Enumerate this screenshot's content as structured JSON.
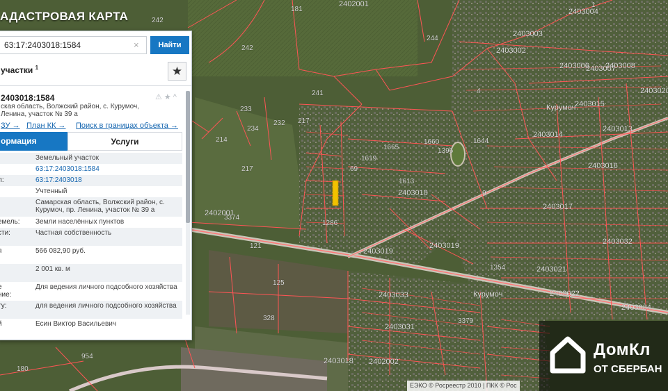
{
  "app": {
    "title": "АДАСТРОВАЯ КАРТА"
  },
  "search": {
    "value": "63:17:2403018:1584",
    "clear_icon": "×",
    "button_label": "Найти"
  },
  "list": {
    "title": "участки",
    "count": "1",
    "star_icon": "★"
  },
  "card": {
    "id": "2403018:1584",
    "address": "ская область, Волжский район, с. Курумоч, Ленина, участок № 39 а",
    "icons": "⚠★^",
    "links": {
      "link1": "ЗУ →",
      "plan_kk": "План КК →",
      "search_bounds": "Поиск в границах объекта →"
    },
    "tabs": {
      "info": "ормация",
      "services": "Услуги"
    },
    "rows": [
      {
        "label": "",
        "value": "Земельный участок"
      },
      {
        "label": "",
        "value": "63:17:2403018:1584"
      },
      {
        "label": "л:",
        "value": "63:17:2403018"
      },
      {
        "label": "",
        "value": "Учтенный"
      },
      {
        "label": "",
        "value": "Самарская область, Волжский район, с. Курумоч, пр. Ленина, участок № 39 а"
      },
      {
        "label": "емель:",
        "value": "Земли населённых пунктов"
      },
      {
        "label": "сти:",
        "value": "Частная собственность"
      },
      {
        "label": "я",
        "value": "566 082,90 руб."
      },
      {
        "label": "",
        "value": "2 001 кв. м"
      },
      {
        "label": "е",
        "value": "Для ведения личного подсобного хозяйства"
      },
      {
        "label": "ние:",
        "value": ""
      },
      {
        "label": "ту:",
        "value": "для ведения личного подсобного хозяйства"
      },
      {
        "label": "й",
        "value": "Есин Виктор Васильевич"
      }
    ]
  },
  "map": {
    "labels": [
      "242",
      "181",
      "2402001",
      "244",
      "242",
      "241",
      "214",
      "233",
      "234",
      "232",
      "217",
      "217",
      "2402001",
      "3374",
      "121",
      "125",
      "328",
      "954",
      "180",
      "2402002",
      "2403018",
      "1665",
      "1619",
      "1660",
      "1396",
      "1644",
      "69",
      "1613",
      "2403018",
      "1286",
      "2403019",
      "2403019",
      "9",
      "1354",
      "2403017",
      "4",
      "Курумоч",
      "2403015",
      "2403014",
      "2403013",
      "2403016",
      "2403002",
      "2403003",
      "2403004",
      "1",
      "2403006",
      "2403007",
      "2403008",
      "2403020",
      "2403021",
      "2403032",
      "2403033",
      "2403031",
      "3379",
      "Курумоч",
      "2403022",
      "2403034"
    ]
  },
  "attribution": "ЕЭКО © Росреестр 2010 | ПКК © Рос",
  "watermark": {
    "text1": "ДомКл",
    "text2": "ОТ СБЕРБАН"
  },
  "colors": {
    "accent": "#1777c3",
    "parcel_border": "#ff4d4d",
    "highlight": "#f2c200",
    "link": "#1566b0"
  }
}
